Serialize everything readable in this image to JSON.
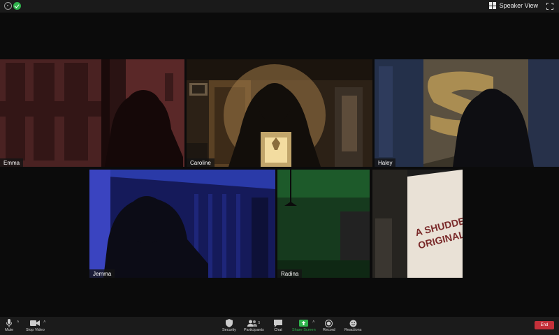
{
  "topbar": {
    "view_label": "Speaker View",
    "icons": [
      "info-icon",
      "encryption-shield-icon",
      "speaker-view-grid-icon",
      "fullscreen-icon"
    ]
  },
  "participants": [
    {
      "name": "Emma"
    },
    {
      "name": "Caroline"
    },
    {
      "name": "Haley"
    },
    {
      "name": "Jemma"
    },
    {
      "name": "Radina"
    }
  ],
  "tile_text": {
    "shudder_line1": "A SHUDDER",
    "shudder_line2": "ORIGINAL"
  },
  "toolbar": {
    "mute": "Mute",
    "stop_video": "Stop Video",
    "security": "Security",
    "participants": "Participants",
    "participants_count": "5",
    "chat": "Chat",
    "share_screen": "Share Screen",
    "record": "Record",
    "reactions": "Reactions",
    "end": "End"
  },
  "colors": {
    "accent_green": "#2fb24c",
    "end_red": "#c5303a",
    "background": "#0b0b0b"
  }
}
